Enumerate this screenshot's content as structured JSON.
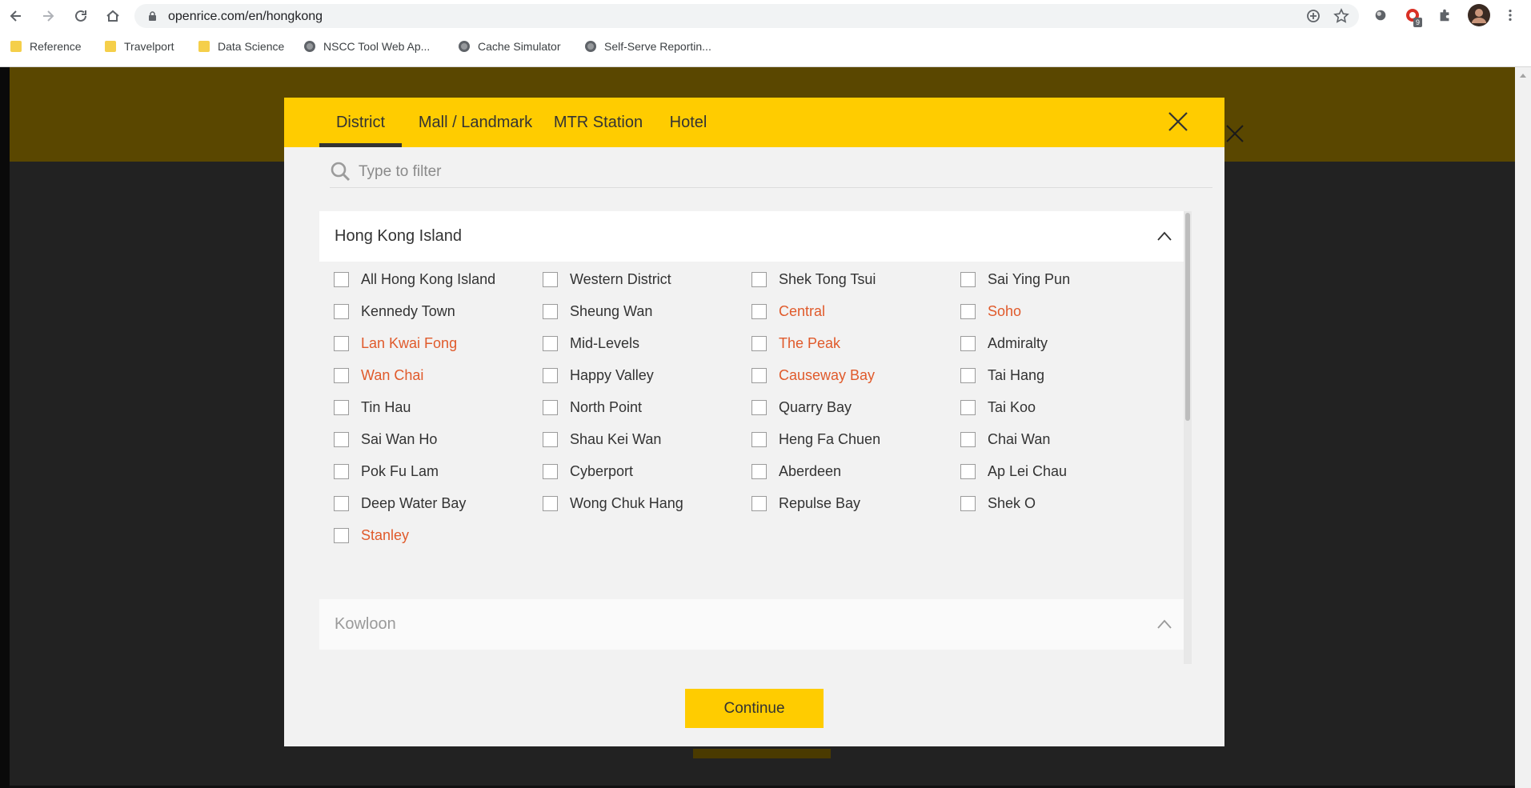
{
  "browser": {
    "url": "openrice.com/en/hongkong",
    "extension_badge": "9",
    "bookmarks": [
      {
        "label": "Reference",
        "icon": "folder-icon"
      },
      {
        "label": "Travelport",
        "icon": "folder-icon"
      },
      {
        "label": "Data Science",
        "icon": "folder-icon"
      },
      {
        "label": "NSCC Tool Web Ap...",
        "icon": "globe-icon"
      },
      {
        "label": "Cache Simulator",
        "icon": "globe-icon"
      },
      {
        "label": "Self-Serve Reportin...",
        "icon": "globe-icon"
      }
    ]
  },
  "modal": {
    "tabs": [
      {
        "label": "District",
        "active": true
      },
      {
        "label": "Mall / Landmark",
        "active": false
      },
      {
        "label": "MTR Station",
        "active": false
      },
      {
        "label": "Hotel",
        "active": false
      }
    ],
    "filter_placeholder": "Type to filter",
    "sections": [
      {
        "title": "Hong Kong Island",
        "expanded": true,
        "options": [
          {
            "label": "All Hong Kong Island",
            "highlight": false
          },
          {
            "label": "Western District",
            "highlight": false
          },
          {
            "label": "Shek Tong Tsui",
            "highlight": false
          },
          {
            "label": "Sai Ying Pun",
            "highlight": false
          },
          {
            "label": "Kennedy Town",
            "highlight": false
          },
          {
            "label": "Sheung Wan",
            "highlight": false
          },
          {
            "label": "Central",
            "highlight": true
          },
          {
            "label": "Soho",
            "highlight": true
          },
          {
            "label": "Lan Kwai Fong",
            "highlight": true
          },
          {
            "label": "Mid-Levels",
            "highlight": false
          },
          {
            "label": "The Peak",
            "highlight": true
          },
          {
            "label": "Admiralty",
            "highlight": false
          },
          {
            "label": "Wan Chai",
            "highlight": true
          },
          {
            "label": "Happy Valley",
            "highlight": false
          },
          {
            "label": "Causeway Bay",
            "highlight": true
          },
          {
            "label": "Tai Hang",
            "highlight": false
          },
          {
            "label": "Tin Hau",
            "highlight": false
          },
          {
            "label": "North Point",
            "highlight": false
          },
          {
            "label": "Quarry Bay",
            "highlight": false
          },
          {
            "label": "Tai Koo",
            "highlight": false
          },
          {
            "label": "Sai Wan Ho",
            "highlight": false
          },
          {
            "label": "Shau Kei Wan",
            "highlight": false
          },
          {
            "label": "Heng Fa Chuen",
            "highlight": false
          },
          {
            "label": "Chai Wan",
            "highlight": false
          },
          {
            "label": "Pok Fu Lam",
            "highlight": false
          },
          {
            "label": "Cyberport",
            "highlight": false
          },
          {
            "label": "Aberdeen",
            "highlight": false
          },
          {
            "label": "Ap Lei Chau",
            "highlight": false
          },
          {
            "label": "Deep Water Bay",
            "highlight": false
          },
          {
            "label": "Wong Chuk Hang",
            "highlight": false
          },
          {
            "label": "Repulse Bay",
            "highlight": false
          },
          {
            "label": "Shek O",
            "highlight": false
          },
          {
            "label": "Stanley",
            "highlight": true
          }
        ]
      },
      {
        "title": "Kowloon",
        "expanded": false,
        "options": []
      }
    ],
    "continue_label": "Continue"
  },
  "colors": {
    "brand_yellow": "#ffcc00",
    "highlight_orange": "#e05a2b",
    "overlay_dark": "#222222"
  }
}
